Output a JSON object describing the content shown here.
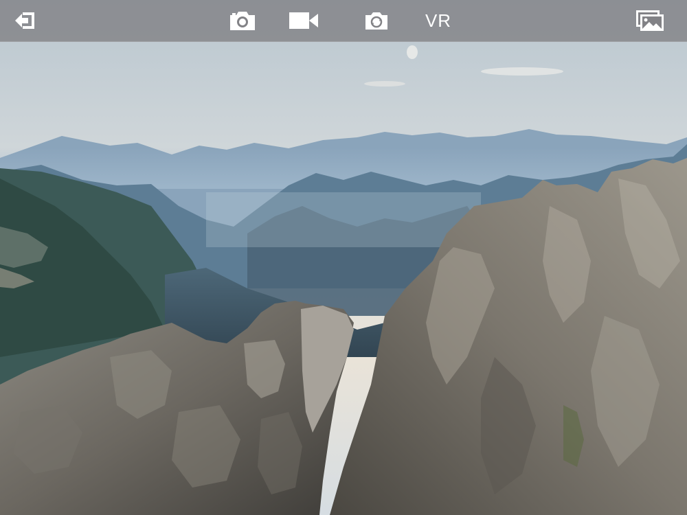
{
  "toolbar": {
    "background": "#828286",
    "icon_color": "#ffffff",
    "buttons": [
      {
        "id": "exit",
        "icon": "exit-icon"
      },
      {
        "id": "photo",
        "icon": "camera-icon"
      },
      {
        "id": "video",
        "icon": "video-camera-icon"
      },
      {
        "id": "switch_camera",
        "icon": "switch-camera-icon"
      },
      {
        "id": "vr",
        "label": "VR"
      },
      {
        "id": "gallery",
        "icon": "gallery-icon"
      }
    ]
  },
  "viewport": {
    "content": "camera-preview"
  }
}
